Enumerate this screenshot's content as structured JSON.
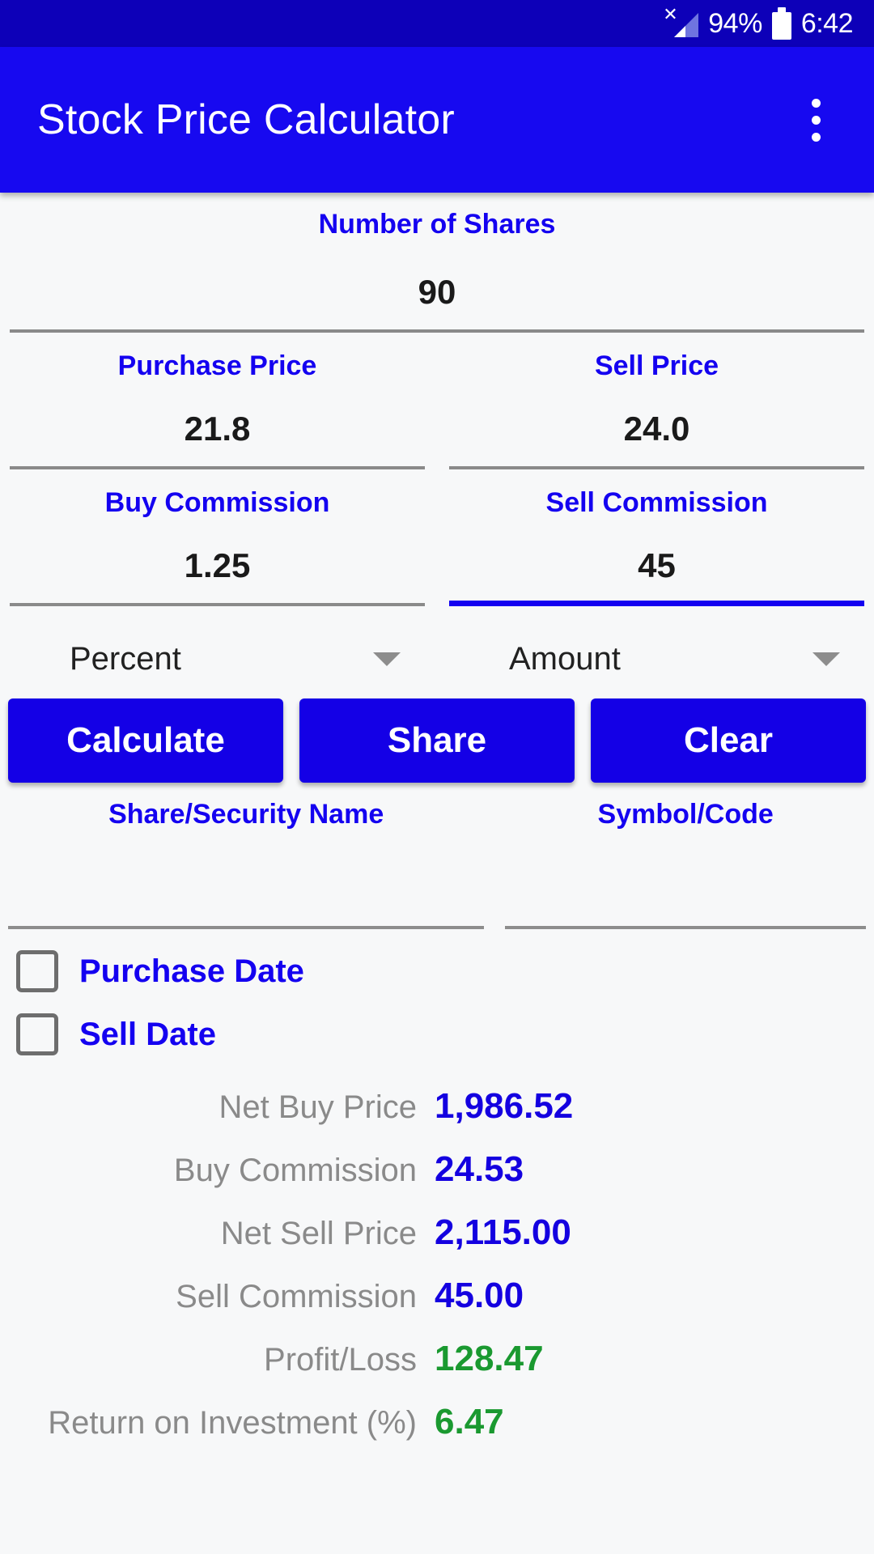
{
  "status_bar": {
    "signal_icon": "no-signal-icon",
    "battery_percent": "94%",
    "battery_icon": "battery-icon",
    "clock": "6:42"
  },
  "app_bar": {
    "title": "Stock Price Calculator",
    "overflow_icon": "more-vertical-icon"
  },
  "form": {
    "shares": {
      "label": "Number of Shares",
      "value": "90"
    },
    "purchase_price": {
      "label": "Purchase Price",
      "value": "21.8"
    },
    "sell_price": {
      "label": "Sell Price",
      "value": "24.0"
    },
    "buy_commission": {
      "label": "Buy Commission",
      "value": "1.25"
    },
    "sell_commission": {
      "label": "Sell Commission",
      "value": "45"
    },
    "buy_commission_type": {
      "value": "Percent"
    },
    "sell_commission_type": {
      "value": "Amount"
    },
    "security_name": {
      "label": "Share/Security Name",
      "value": ""
    },
    "symbol_code": {
      "label": "Symbol/Code",
      "value": ""
    },
    "purchase_date": {
      "label": "Purchase Date",
      "checked": false
    },
    "sell_date": {
      "label": "Sell Date",
      "checked": false
    }
  },
  "buttons": {
    "calculate": "Calculate",
    "share": "Share",
    "clear": "Clear"
  },
  "results": [
    {
      "label": "Net Buy Price",
      "value": "1,986.52",
      "positive": false
    },
    {
      "label": "Buy Commission",
      "value": "24.53",
      "positive": false
    },
    {
      "label": "Net Sell Price",
      "value": "2,115.00",
      "positive": false
    },
    {
      "label": "Sell Commission",
      "value": "45.00",
      "positive": false
    },
    {
      "label": "Profit/Loss",
      "value": "128.47",
      "positive": true
    },
    {
      "label": "Return on Investment (%)",
      "value": "6.47",
      "positive": true
    }
  ],
  "colors": {
    "status_bar": "#0d00b8",
    "app_bar": "#1709f0",
    "accent_blue": "#1400f0",
    "positive_green": "#1a9930",
    "label_gray": "#8a8a8a",
    "background": "#f7f8f9"
  }
}
